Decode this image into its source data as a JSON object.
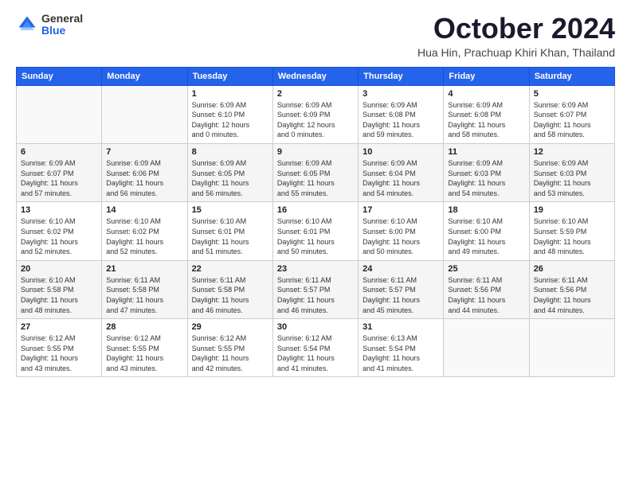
{
  "header": {
    "logo_general": "General",
    "logo_blue": "Blue",
    "month_title": "October 2024",
    "location": "Hua Hin, Prachuap Khiri Khan, Thailand"
  },
  "days_of_week": [
    "Sunday",
    "Monday",
    "Tuesday",
    "Wednesday",
    "Thursday",
    "Friday",
    "Saturday"
  ],
  "weeks": [
    [
      {
        "day": "",
        "info": ""
      },
      {
        "day": "",
        "info": ""
      },
      {
        "day": "1",
        "info": "Sunrise: 6:09 AM\nSunset: 6:10 PM\nDaylight: 12 hours\nand 0 minutes."
      },
      {
        "day": "2",
        "info": "Sunrise: 6:09 AM\nSunset: 6:09 PM\nDaylight: 12 hours\nand 0 minutes."
      },
      {
        "day": "3",
        "info": "Sunrise: 6:09 AM\nSunset: 6:08 PM\nDaylight: 11 hours\nand 59 minutes."
      },
      {
        "day": "4",
        "info": "Sunrise: 6:09 AM\nSunset: 6:08 PM\nDaylight: 11 hours\nand 58 minutes."
      },
      {
        "day": "5",
        "info": "Sunrise: 6:09 AM\nSunset: 6:07 PM\nDaylight: 11 hours\nand 58 minutes."
      }
    ],
    [
      {
        "day": "6",
        "info": "Sunrise: 6:09 AM\nSunset: 6:07 PM\nDaylight: 11 hours\nand 57 minutes."
      },
      {
        "day": "7",
        "info": "Sunrise: 6:09 AM\nSunset: 6:06 PM\nDaylight: 11 hours\nand 56 minutes."
      },
      {
        "day": "8",
        "info": "Sunrise: 6:09 AM\nSunset: 6:05 PM\nDaylight: 11 hours\nand 56 minutes."
      },
      {
        "day": "9",
        "info": "Sunrise: 6:09 AM\nSunset: 6:05 PM\nDaylight: 11 hours\nand 55 minutes."
      },
      {
        "day": "10",
        "info": "Sunrise: 6:09 AM\nSunset: 6:04 PM\nDaylight: 11 hours\nand 54 minutes."
      },
      {
        "day": "11",
        "info": "Sunrise: 6:09 AM\nSunset: 6:03 PM\nDaylight: 11 hours\nand 54 minutes."
      },
      {
        "day": "12",
        "info": "Sunrise: 6:09 AM\nSunset: 6:03 PM\nDaylight: 11 hours\nand 53 minutes."
      }
    ],
    [
      {
        "day": "13",
        "info": "Sunrise: 6:10 AM\nSunset: 6:02 PM\nDaylight: 11 hours\nand 52 minutes."
      },
      {
        "day": "14",
        "info": "Sunrise: 6:10 AM\nSunset: 6:02 PM\nDaylight: 11 hours\nand 52 minutes."
      },
      {
        "day": "15",
        "info": "Sunrise: 6:10 AM\nSunset: 6:01 PM\nDaylight: 11 hours\nand 51 minutes."
      },
      {
        "day": "16",
        "info": "Sunrise: 6:10 AM\nSunset: 6:01 PM\nDaylight: 11 hours\nand 50 minutes."
      },
      {
        "day": "17",
        "info": "Sunrise: 6:10 AM\nSunset: 6:00 PM\nDaylight: 11 hours\nand 50 minutes."
      },
      {
        "day": "18",
        "info": "Sunrise: 6:10 AM\nSunset: 6:00 PM\nDaylight: 11 hours\nand 49 minutes."
      },
      {
        "day": "19",
        "info": "Sunrise: 6:10 AM\nSunset: 5:59 PM\nDaylight: 11 hours\nand 48 minutes."
      }
    ],
    [
      {
        "day": "20",
        "info": "Sunrise: 6:10 AM\nSunset: 5:58 PM\nDaylight: 11 hours\nand 48 minutes."
      },
      {
        "day": "21",
        "info": "Sunrise: 6:11 AM\nSunset: 5:58 PM\nDaylight: 11 hours\nand 47 minutes."
      },
      {
        "day": "22",
        "info": "Sunrise: 6:11 AM\nSunset: 5:58 PM\nDaylight: 11 hours\nand 46 minutes."
      },
      {
        "day": "23",
        "info": "Sunrise: 6:11 AM\nSunset: 5:57 PM\nDaylight: 11 hours\nand 46 minutes."
      },
      {
        "day": "24",
        "info": "Sunrise: 6:11 AM\nSunset: 5:57 PM\nDaylight: 11 hours\nand 45 minutes."
      },
      {
        "day": "25",
        "info": "Sunrise: 6:11 AM\nSunset: 5:56 PM\nDaylight: 11 hours\nand 44 minutes."
      },
      {
        "day": "26",
        "info": "Sunrise: 6:11 AM\nSunset: 5:56 PM\nDaylight: 11 hours\nand 44 minutes."
      }
    ],
    [
      {
        "day": "27",
        "info": "Sunrise: 6:12 AM\nSunset: 5:55 PM\nDaylight: 11 hours\nand 43 minutes."
      },
      {
        "day": "28",
        "info": "Sunrise: 6:12 AM\nSunset: 5:55 PM\nDaylight: 11 hours\nand 43 minutes."
      },
      {
        "day": "29",
        "info": "Sunrise: 6:12 AM\nSunset: 5:55 PM\nDaylight: 11 hours\nand 42 minutes."
      },
      {
        "day": "30",
        "info": "Sunrise: 6:12 AM\nSunset: 5:54 PM\nDaylight: 11 hours\nand 41 minutes."
      },
      {
        "day": "31",
        "info": "Sunrise: 6:13 AM\nSunset: 5:54 PM\nDaylight: 11 hours\nand 41 minutes."
      },
      {
        "day": "",
        "info": ""
      },
      {
        "day": "",
        "info": ""
      }
    ]
  ]
}
